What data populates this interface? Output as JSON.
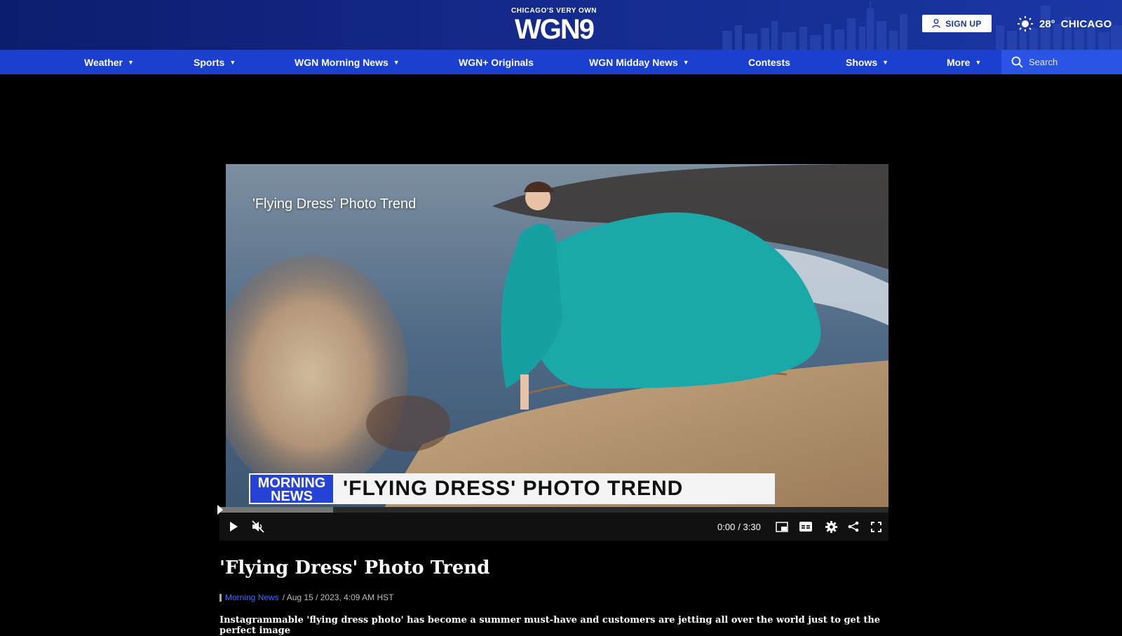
{
  "header": {
    "logo_tagline": "CHICAGO'S VERY OWN",
    "logo_text": "WGN9",
    "signup_label": "SIGN UP",
    "weather_icon": "sun-icon",
    "temperature": "28°",
    "city": "CHICAGO"
  },
  "nav": {
    "items": [
      {
        "label": "Weather",
        "has_dropdown": true
      },
      {
        "label": "Sports",
        "has_dropdown": true
      },
      {
        "label": "WGN Morning News",
        "has_dropdown": true
      },
      {
        "label": "WGN+ Originals",
        "has_dropdown": false
      },
      {
        "label": "WGN Midday News",
        "has_dropdown": true
      },
      {
        "label": "Contests",
        "has_dropdown": false
      },
      {
        "label": "Shows",
        "has_dropdown": true
      },
      {
        "label": "More",
        "has_dropdown": true
      }
    ],
    "caret": "▼",
    "search_placeholder": "Search"
  },
  "video": {
    "overlay_title": "'Flying Dress' Photo Trend",
    "lower_third_badge_line1": "MORNING",
    "lower_third_badge_line2": "NEWS",
    "lower_third_text": "'FLYING DRESS' PHOTO TREND",
    "current_time": "0:00",
    "duration": "/ 3:30",
    "buffered_fraction": 0.17,
    "played_fraction": 0
  },
  "article": {
    "headline": "'Flying Dress' Photo Trend",
    "category": "Morning News",
    "date": "/ Aug 15 / 2023, 4:09 AM HST",
    "lede": "Instagrammable 'flying dress photo' has become a summer must-have and customers are jetting all over the world just to get the perfect image"
  },
  "colors": {
    "header_bg": "#14298a",
    "nav_bg": "#1b3fcf",
    "search_bg": "#2a54e6",
    "link": "#3d6cff",
    "badge": "#2643d8"
  }
}
